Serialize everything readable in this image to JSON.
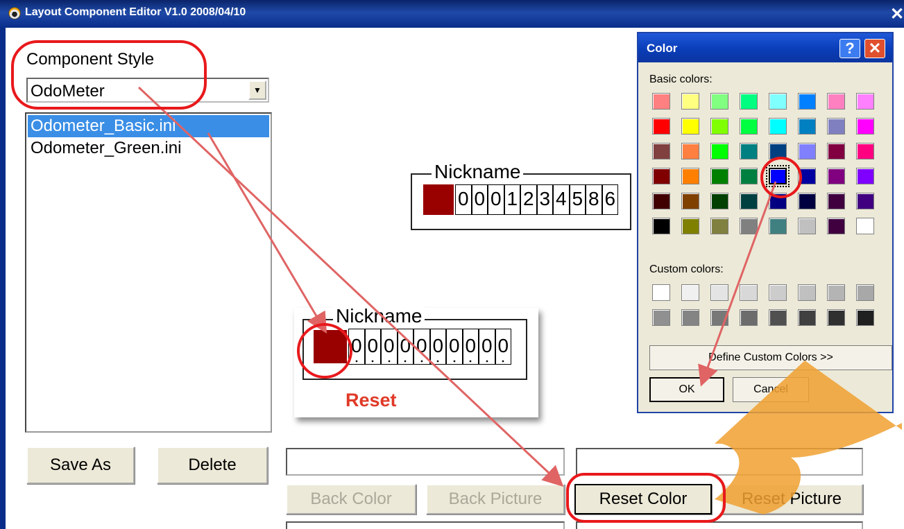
{
  "window": {
    "title": "Layout Component Editor V1.0  2008/04/10",
    "close_glyph": "✕"
  },
  "component_style": {
    "label": "Component Style",
    "selected": "OdoMeter",
    "dropdown_glyph": "▼",
    "files": [
      "Odometer_Basic.ini",
      "Odometer_Green.ini"
    ]
  },
  "buttons": {
    "save_as": "Save As",
    "delete": "Delete",
    "back_color": "Back Color",
    "back_picture": "Back Picture",
    "reset_color": "Reset Color",
    "reset_picture": "Reset Picture"
  },
  "preview": {
    "nickname": "Nickname",
    "color": "#990000",
    "digits": [
      "0",
      "0",
      "0",
      "1",
      "2",
      "3",
      "4",
      "5",
      "8",
      "6"
    ]
  },
  "reset_preview": {
    "nickname": "Nickname",
    "color": "#990000",
    "digits": [
      "0",
      "0",
      "0",
      "0",
      "0",
      "0",
      "0",
      "0",
      "0",
      "0"
    ],
    "caption": "Reset"
  },
  "color_dialog": {
    "title": "Color",
    "help_glyph": "?",
    "close_glyph": "✕",
    "basic_label": "Basic colors:",
    "custom_label": "Custom colors:",
    "basic_colors": [
      "#ff8080",
      "#ffff80",
      "#80ff80",
      "#00ff80",
      "#80ffff",
      "#0080ff",
      "#ff80c0",
      "#ff80ff",
      "#ff0000",
      "#ffff00",
      "#80ff00",
      "#00ff40",
      "#00ffff",
      "#0080c0",
      "#8080c0",
      "#ff00ff",
      "#804040",
      "#ff8040",
      "#00ff00",
      "#008080",
      "#004080",
      "#8080ff",
      "#800040",
      "#ff0080",
      "#800000",
      "#ff8000",
      "#008000",
      "#008040",
      "#0000ff",
      "#0000a0",
      "#800080",
      "#8000ff",
      "#400000",
      "#804000",
      "#004000",
      "#004040",
      "#000080",
      "#000040",
      "#400040",
      "#400080",
      "#000000",
      "#808000",
      "#808040",
      "#808080",
      "#408080",
      "#c0c0c0",
      "#400040",
      "#ffffff"
    ],
    "selected_color": "#0000ff",
    "custom_colors": [
      "#ffffff",
      "#f0f0f0",
      "#e4e4e4",
      "#d8d8d8",
      "#cccccc",
      "#c0c0c0",
      "#b4b4b4",
      "#a8a8a8",
      "#909090",
      "#848484",
      "#787878",
      "#6c6c6c",
      "#505050",
      "#404040",
      "#303030",
      "#202020"
    ],
    "define_custom": "Define Custom Colors >>",
    "ok": "OK",
    "cancel": "Cancel"
  },
  "annotation_colors": {
    "circle": "#e8191c",
    "arrow": "#e06464",
    "big_arrow": "#f0a030"
  }
}
